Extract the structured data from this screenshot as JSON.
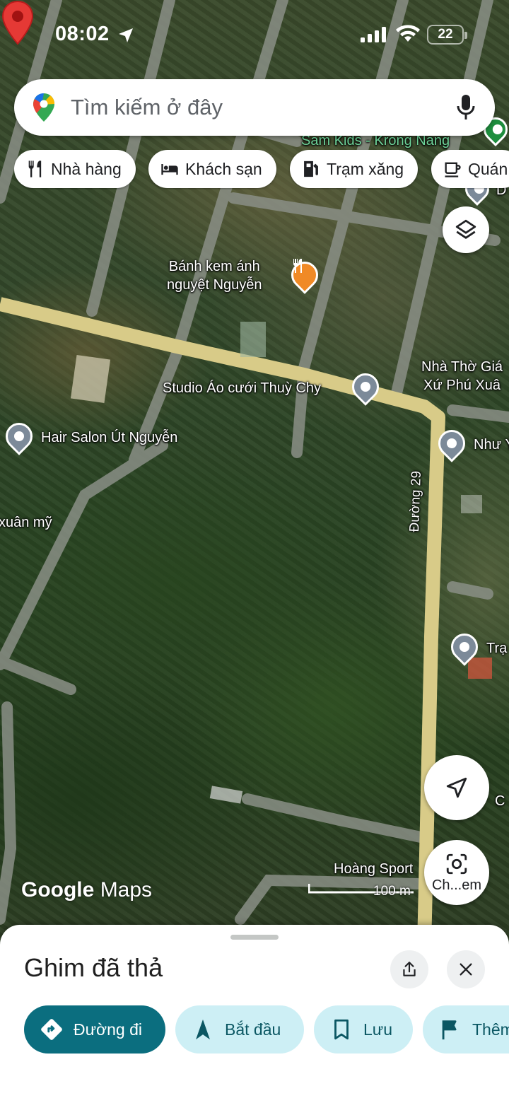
{
  "status_bar": {
    "time": "08:02",
    "battery": "22"
  },
  "search": {
    "placeholder": "Tìm kiếm ở đây"
  },
  "chips": [
    {
      "label": "Nhà hàng",
      "icon": "restaurant-icon"
    },
    {
      "label": "Khách sạn",
      "icon": "hotel-icon"
    },
    {
      "label": "Trạm xăng",
      "icon": "gas-station-icon"
    },
    {
      "label": "Quán",
      "icon": "cafe-icon"
    }
  ],
  "map": {
    "labels": {
      "sam_kids": "Sam Kids - Krong Nang",
      "banh_kem_line1": "Bánh kem ánh",
      "banh_kem_line2": "nguyệt Nguyễn",
      "nha_tho_line1": "Nhà Thờ Giá",
      "nha_tho_line2": "Xứ Phú Xuâ",
      "studio": "Studio Áo cưới Thuỳ Chy",
      "hair_salon": "Hair Salon Út Nguyễn",
      "nhu_y": "Như Ý",
      "xuan_my": "xuân mỹ",
      "tram": "Trạ",
      "c_partial": "C",
      "hoang_sport": "Hoàng Sport",
      "duong_29": "Đường 29",
      "d_partial": "D"
    },
    "scale": "100 m",
    "brand_google": "Google",
    "brand_maps": "Maps",
    "lens_label": "Ch...em"
  },
  "sheet": {
    "title": "Ghim đã thả",
    "actions": [
      {
        "label": "Đường đi",
        "icon": "directions-icon"
      },
      {
        "label": "Bắt đầu",
        "icon": "navigation-arrow-icon"
      },
      {
        "label": "Lưu",
        "icon": "bookmark-icon"
      },
      {
        "label": "Thêm",
        "icon": "flag-icon"
      }
    ]
  },
  "colors": {
    "primary_action": "#0b6e7f",
    "secondary_action": "#cdeff5",
    "road": "#d9cc8a",
    "pin_red": "#e53935",
    "poi_food": "#f08a26"
  }
}
